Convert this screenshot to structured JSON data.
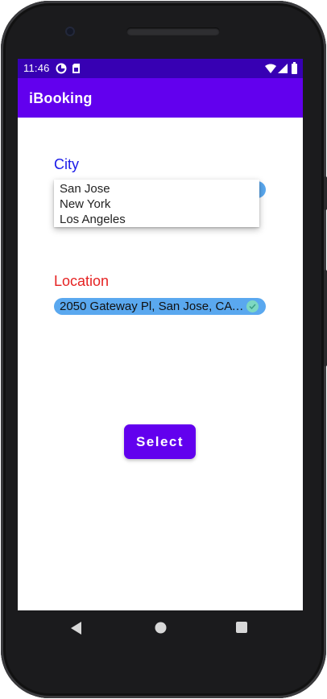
{
  "status_bar": {
    "time": "11:46",
    "background": "#3700b3"
  },
  "app_bar": {
    "title": "iBooking",
    "background": "#6200ee"
  },
  "city": {
    "label": "City",
    "label_color": "#1a1ae8",
    "dropdown_open": true,
    "options": [
      "San Jose",
      "New York",
      "Los Angeles"
    ]
  },
  "location": {
    "label": "Location",
    "label_color": "#e52222",
    "value": "2050 Gateway Pl, San Jose, CA 951..."
  },
  "select_button": {
    "label": "Select",
    "background": "#6200ee"
  },
  "icons": {
    "status_left": [
      "data-saver-icon",
      "sim-card-icon"
    ],
    "status_right": [
      "wifi-icon",
      "signal-icon",
      "battery-icon"
    ],
    "nav": [
      "back-icon",
      "home-icon",
      "recents-icon"
    ]
  }
}
